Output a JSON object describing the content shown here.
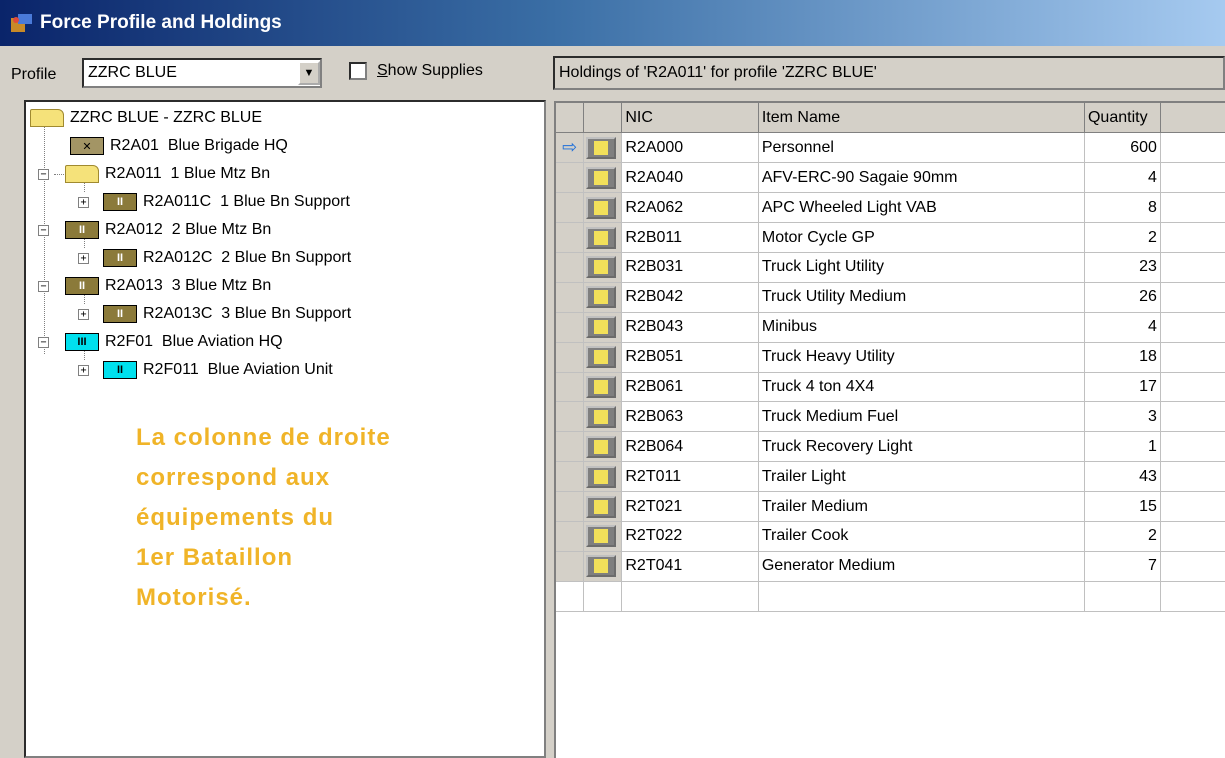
{
  "window": {
    "title": "Force Profile and Holdings"
  },
  "profile": {
    "label": "Profile",
    "value": "ZZRC BLUE"
  },
  "show_supplies": {
    "label_pre": "",
    "label_underline": "S",
    "label_rest": "how Supplies",
    "checked": false
  },
  "tree": {
    "root": "ZZRC BLUE - ZZRC BLUE",
    "nodes": [
      {
        "code": "R2A01",
        "name": "Blue Brigade HQ",
        "icon": "x"
      },
      {
        "code": "R2A011",
        "name": "1 Blue Mtz Bn",
        "icon": "folder-open"
      },
      {
        "code": "R2A011C",
        "name": "1 Blue Bn Support",
        "icon": "II"
      },
      {
        "code": "R2A012",
        "name": "2 Blue Mtz Bn",
        "icon": "II"
      },
      {
        "code": "R2A012C",
        "name": "2 Blue Bn Support",
        "icon": "II"
      },
      {
        "code": "R2A013",
        "name": "3 Blue Mtz Bn",
        "icon": "II"
      },
      {
        "code": "R2A013C",
        "name": "3 Blue Bn Support",
        "icon": "II"
      },
      {
        "code": "R2F01",
        "name": "Blue Aviation HQ",
        "icon": "III"
      },
      {
        "code": "R2F011",
        "name": "Blue Aviation Unit",
        "icon": "II"
      }
    ]
  },
  "annotation": {
    "lines": [
      "La colonne de droite",
      "correspond aux",
      "équipements du",
      "1er Bataillon",
      "Motorisé."
    ],
    "color": "#f0b428"
  },
  "holdings": {
    "header": "Holdings of 'R2A011' for profile 'ZZRC BLUE'",
    "columns": {
      "nic": "NIC",
      "item": "Item Name",
      "qty": "Quantity"
    },
    "rows": [
      {
        "nic": "R2A000",
        "item": "Personnel",
        "qty": "600",
        "current": true
      },
      {
        "nic": "R2A040",
        "item": "AFV-ERC-90 Sagaie 90mm",
        "qty": "4"
      },
      {
        "nic": "R2A062",
        "item": "APC Wheeled Light VAB",
        "qty": "8"
      },
      {
        "nic": "R2B011",
        "item": "Motor Cycle GP",
        "qty": "2"
      },
      {
        "nic": "R2B031",
        "item": "Truck Light Utility",
        "qty": "23"
      },
      {
        "nic": "R2B042",
        "item": "Truck Utility Medium",
        "qty": "26"
      },
      {
        "nic": "R2B043",
        "item": "Minibus",
        "qty": "4"
      },
      {
        "nic": "R2B051",
        "item": "Truck Heavy Utility",
        "qty": "18"
      },
      {
        "nic": "R2B061",
        "item": "Truck 4 ton 4X4",
        "qty": "17"
      },
      {
        "nic": "R2B063",
        "item": "Truck Medium Fuel",
        "qty": "3"
      },
      {
        "nic": "R2B064",
        "item": "Truck Recovery Light",
        "qty": "1"
      },
      {
        "nic": "R2T011",
        "item": "Trailer Light",
        "qty": "43"
      },
      {
        "nic": "R2T021",
        "item": "Trailer Medium",
        "qty": "15"
      },
      {
        "nic": "R2T022",
        "item": "Trailer Cook",
        "qty": "2"
      },
      {
        "nic": "R2T041",
        "item": "Generator Medium",
        "qty": "7"
      }
    ]
  }
}
